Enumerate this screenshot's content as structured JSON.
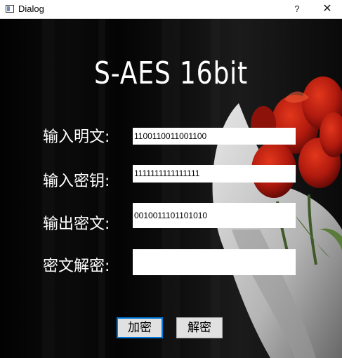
{
  "window": {
    "title": "Dialog",
    "help_label": "?",
    "close_label": "✕"
  },
  "heading": "S-AES 16bit",
  "form": {
    "plaintext_label": "输入明文:",
    "plaintext_value": "1100110011001100",
    "key_label": "输入密钥:",
    "key_value": "1111111111111111",
    "ciphertext_label": "输出密文:",
    "ciphertext_value": "0010011101101010",
    "decrypt_label": "密文解密:",
    "decrypt_value": ""
  },
  "buttons": {
    "encrypt": "加密",
    "decrypt": "解密"
  }
}
